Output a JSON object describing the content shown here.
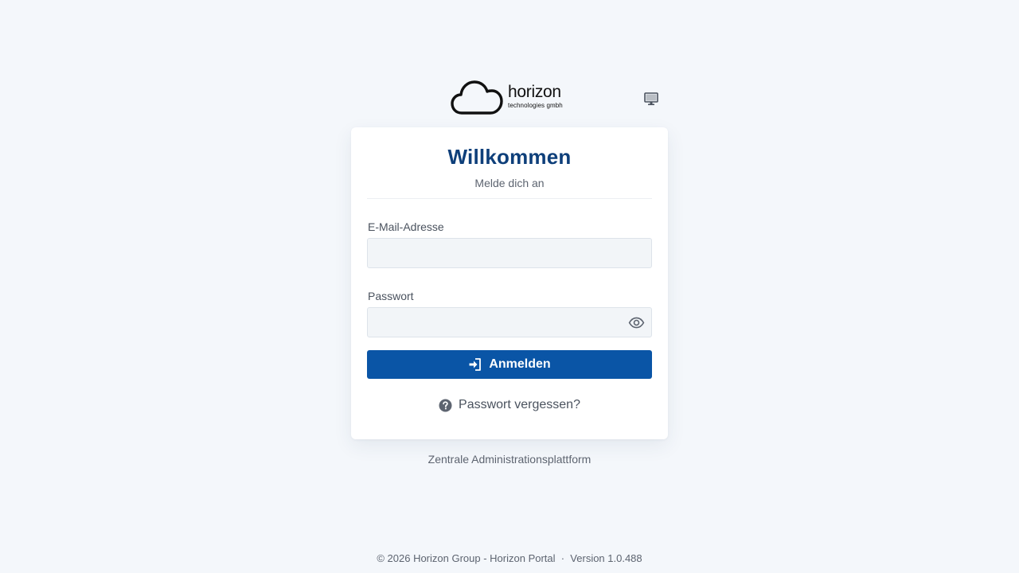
{
  "brand": {
    "name": "horizon",
    "subtitle": "technologies gmbh"
  },
  "card": {
    "title": "Willkommen",
    "subtitle": "Melde dich an"
  },
  "form": {
    "email_label": "E-Mail-Adresse",
    "email_value": "",
    "password_label": "Passwort",
    "password_value": "",
    "submit_label": "Anmelden",
    "forgot_label": "Passwort vergessen?"
  },
  "caption": "Zentrale Administrationsplattform",
  "footer": "© 2026 Horizon Group - Horizon Portal  ·  Version 1.0.488",
  "icons": {
    "logo": "cloud-icon",
    "display": "monitor-icon",
    "password_toggle": "eye-icon",
    "submit": "sign-in-icon",
    "forgot": "question-circle-icon"
  },
  "colors": {
    "background": "#f4f7fb",
    "title": "#0e3f7a",
    "primary_button": "#0a55a6",
    "input_background": "#f2f5f8"
  }
}
